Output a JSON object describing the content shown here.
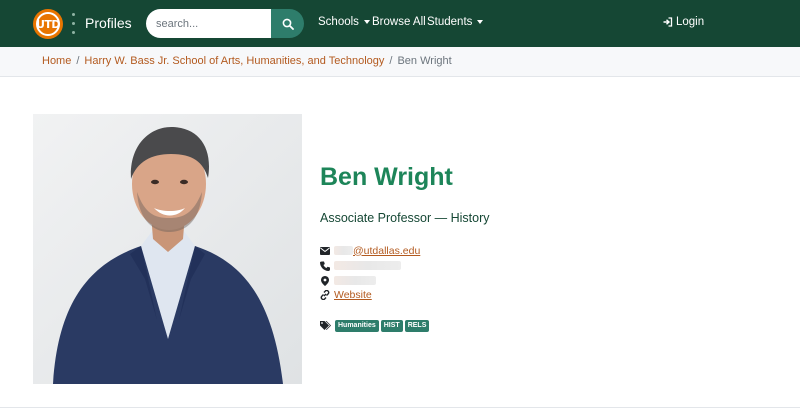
{
  "navbar": {
    "logo_text": "UTD",
    "brand": "Profiles",
    "search_placeholder": "search...",
    "menu": {
      "schools": "Schools",
      "browse_all": "Browse All",
      "students": "Students",
      "login": "Login"
    }
  },
  "breadcrumb": {
    "home": "Home",
    "school": "Harry W. Bass Jr. School of Arts, Humanities, and Technology",
    "current": "Ben Wright"
  },
  "profile": {
    "name": "Ben Wright",
    "title": "Associate Professor — History",
    "email_suffix": "@utdallas.edu",
    "website_label": "Website",
    "tags": [
      "Humanities",
      "HIST",
      "RELS"
    ]
  },
  "colors": {
    "navbar": "#154734",
    "accent_orange": "#e87500",
    "link": "#b35a1f",
    "name": "#1d8559",
    "badge": "#2e7d6b"
  },
  "icons": [
    "search-icon",
    "sign-in-icon",
    "envelope-icon",
    "phone-icon",
    "map-marker-icon",
    "link-icon",
    "tags-icon"
  ]
}
